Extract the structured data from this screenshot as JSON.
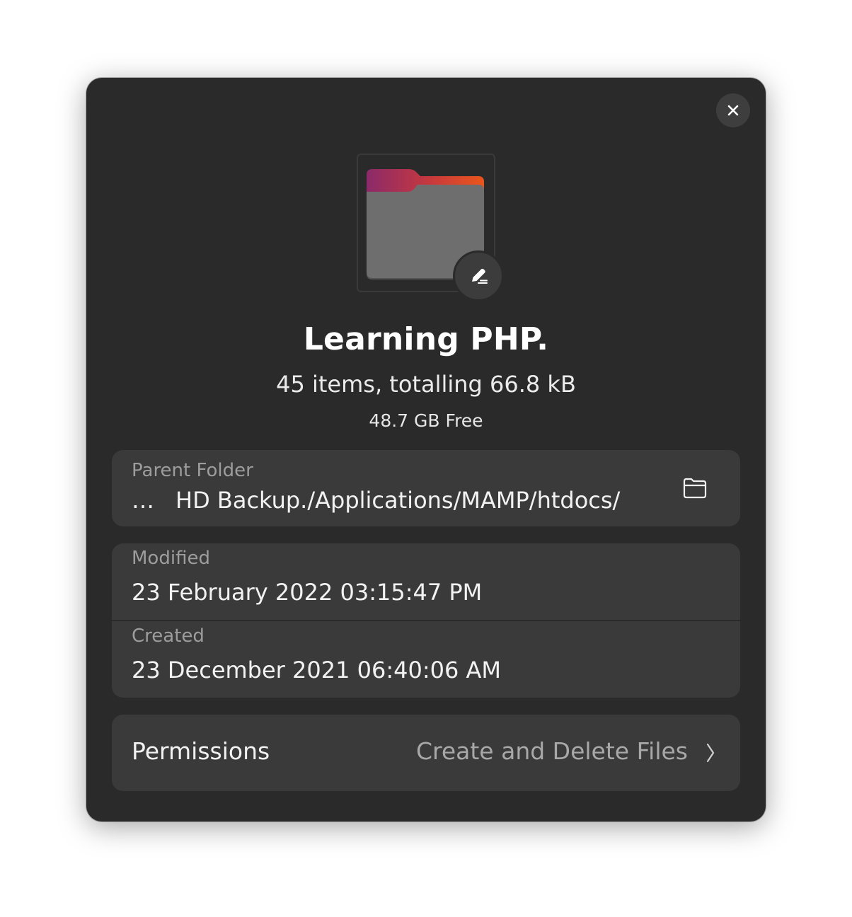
{
  "dialog": {
    "title": "Learning PHP.",
    "summary": "45 items, totalling 66.8 kB",
    "free_space": "48.7 GB Free",
    "close_icon": "close-icon",
    "folder_icon": "folder-icon",
    "edit_icon": "edit-icon"
  },
  "parent_folder": {
    "label": "Parent Folder",
    "ellipsis": "…",
    "path": "HD Backup./Applications/MAMP/htdocs/",
    "open_icon": "open-folder-icon"
  },
  "dates": {
    "modified_label": "Modified",
    "modified_value": "23 February 2022 03:15:47 PM",
    "created_label": "Created",
    "created_value": "23 December 2021 06:40:06 AM"
  },
  "permissions": {
    "label": "Permissions",
    "value": "Create and Delete Files",
    "chevron_icon": "chevron-right-icon"
  },
  "colors": {
    "dialog_bg": "#2a2a2a",
    "card_bg": "#3a3a3a",
    "folder_accent_start": "#8b2a6a",
    "folder_accent_end": "#e9541c",
    "folder_body": "#6e6e6e"
  }
}
